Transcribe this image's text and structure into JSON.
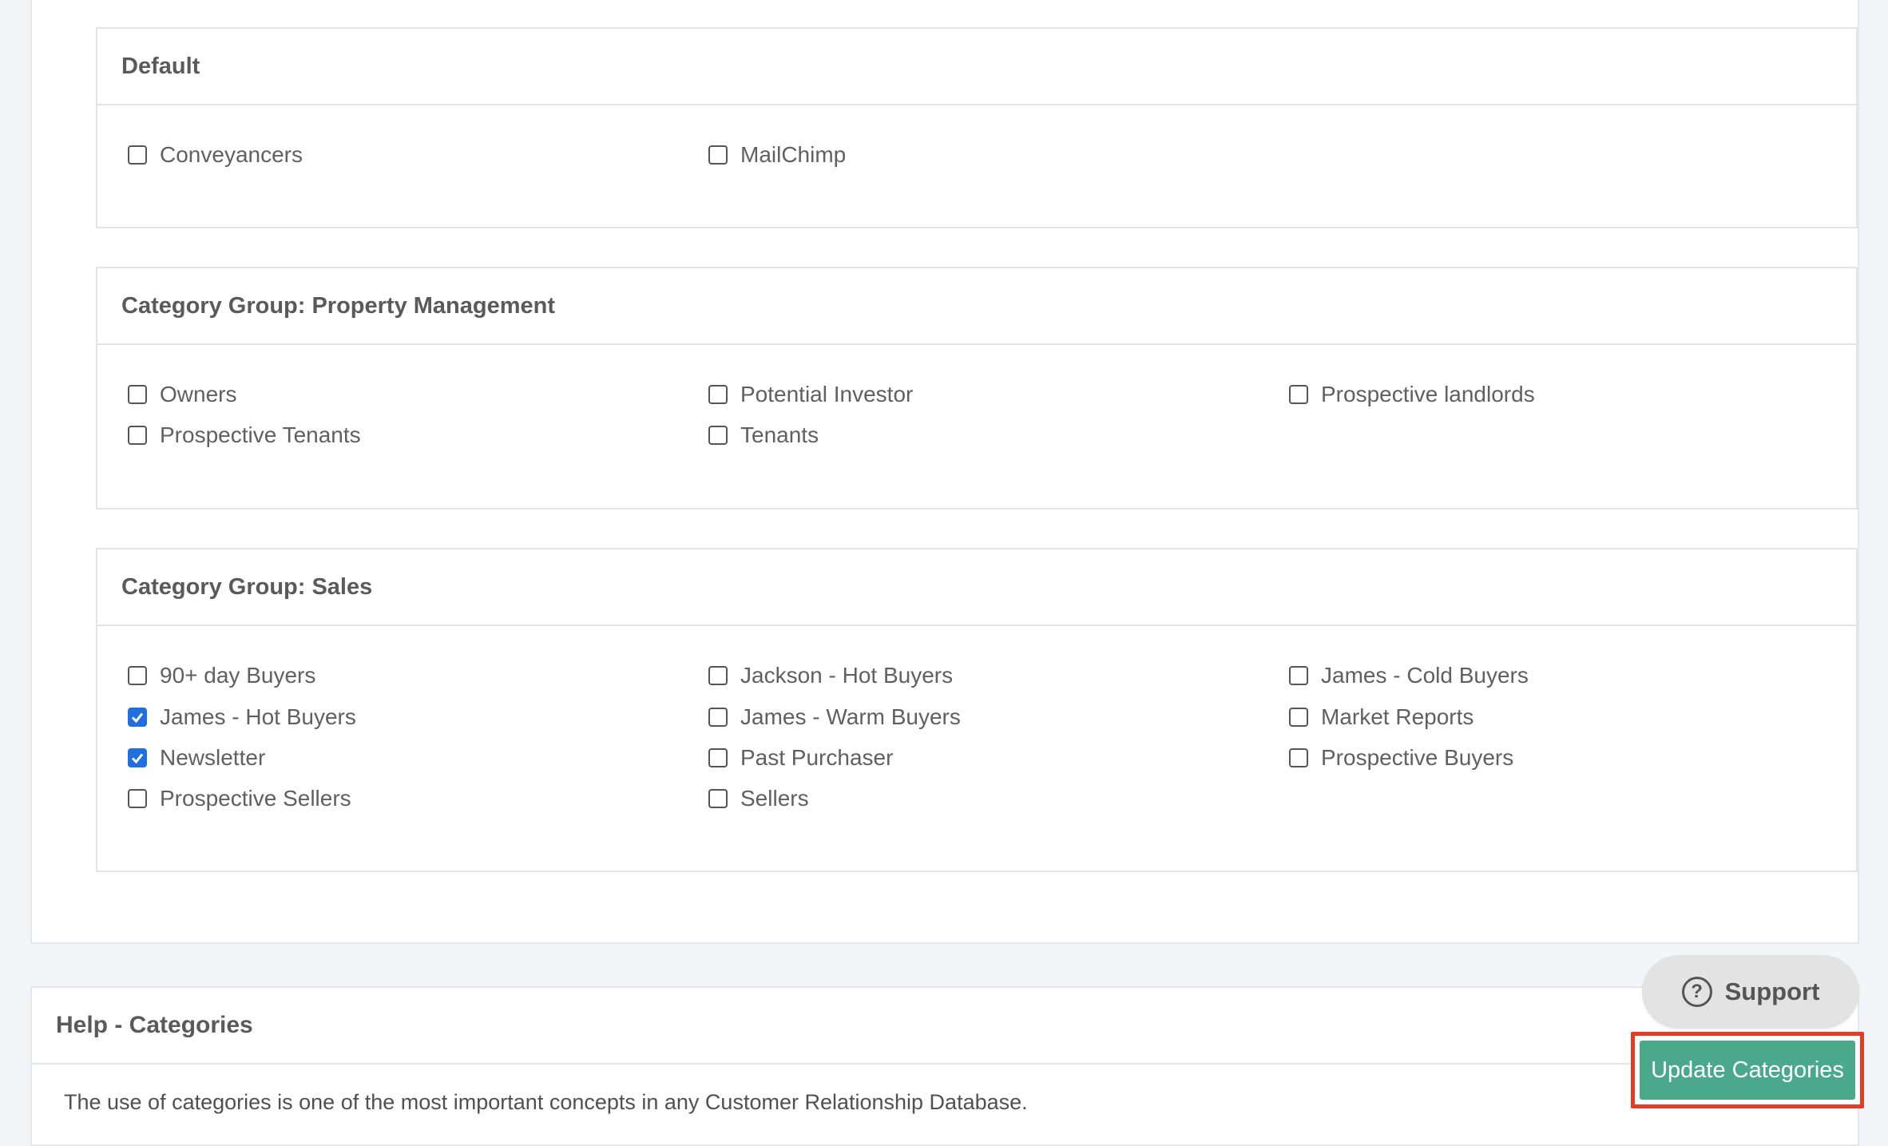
{
  "groups": [
    {
      "title": "Default",
      "items": [
        {
          "label": "Conveyancers",
          "checked": false
        },
        {
          "label": "MailChimp",
          "checked": false
        }
      ]
    },
    {
      "title": "Category Group: Property Management",
      "items": [
        {
          "label": "Owners",
          "checked": false
        },
        {
          "label": "Potential Investor",
          "checked": false
        },
        {
          "label": "Prospective landlords",
          "checked": false
        },
        {
          "label": "Prospective Tenants",
          "checked": false
        },
        {
          "label": "Tenants",
          "checked": false
        }
      ]
    },
    {
      "title": "Category Group: Sales",
      "items": [
        {
          "label": "90+ day Buyers",
          "checked": false
        },
        {
          "label": "Jackson - Hot Buyers",
          "checked": false
        },
        {
          "label": "James - Cold Buyers",
          "checked": false
        },
        {
          "label": "James - Hot Buyers",
          "checked": true
        },
        {
          "label": "James - Warm Buyers",
          "checked": false
        },
        {
          "label": "Market Reports",
          "checked": false
        },
        {
          "label": "Newsletter",
          "checked": true
        },
        {
          "label": "Past Purchaser",
          "checked": false
        },
        {
          "label": "Prospective Buyers",
          "checked": false
        },
        {
          "label": "Prospective Sellers",
          "checked": false
        },
        {
          "label": "Sellers",
          "checked": false
        }
      ]
    }
  ],
  "help": {
    "title": "Help - Categories",
    "text": "The use of categories is one of the most important concepts in any Customer Relationship Database."
  },
  "support_label": "Support",
  "update_label": "Update Categories",
  "colors": {
    "accent_button": "#4aa98a",
    "highlight_border": "#e53a23",
    "checkbox_checked": "#1f6fe0"
  }
}
